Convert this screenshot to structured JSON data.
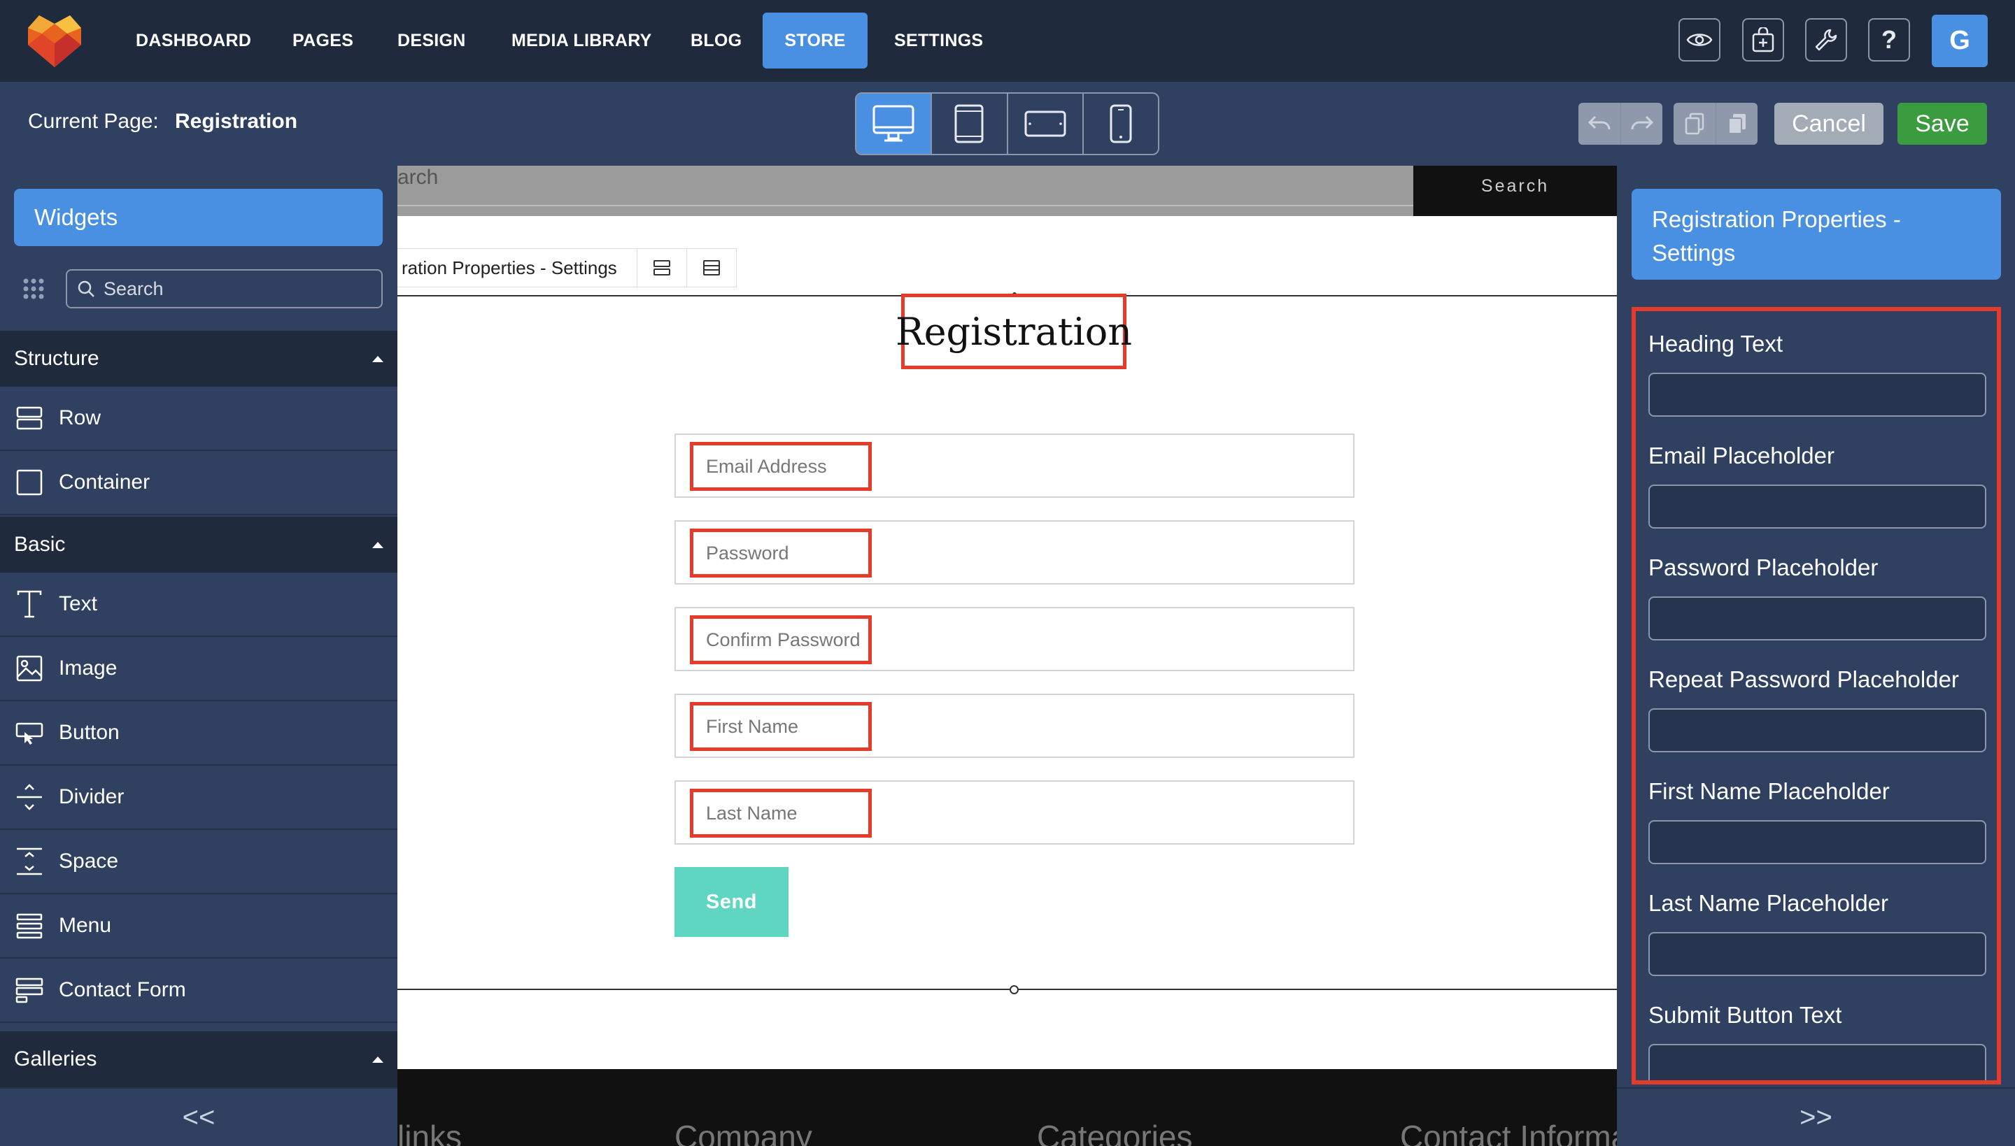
{
  "nav": {
    "items": [
      "DASHBOARD",
      "PAGES",
      "DESIGN",
      "MEDIA LIBRARY",
      "BLOG",
      "STORE",
      "SETTINGS"
    ],
    "active": "STORE",
    "avatar_letter": "G",
    "icons": [
      "preview-eye-icon",
      "store-bag-icon",
      "tools-wrench-icon",
      "help-question-icon"
    ]
  },
  "subbar": {
    "current_page_label": "Current Page:",
    "current_page_value": "Registration",
    "devices": [
      "desktop-icon",
      "tablet-portrait-icon",
      "tablet-landscape-icon",
      "phone-icon"
    ],
    "active_device": "desktop",
    "cancel_label": "Cancel",
    "save_label": "Save"
  },
  "left": {
    "header": "Widgets",
    "search_placeholder": "Search",
    "sections": [
      {
        "title": "Structure",
        "items": [
          "Row",
          "Container"
        ]
      },
      {
        "title": "Basic",
        "items": [
          "Text",
          "Image",
          "Button",
          "Divider",
          "Space",
          "Menu",
          "Contact Form"
        ]
      },
      {
        "title": "Galleries",
        "items": []
      }
    ],
    "collapse_label": "<<"
  },
  "canvas": {
    "top_search_partial": "arch",
    "top_search_button": "Search",
    "breadcrumb": "ration Properties - Settings",
    "heading": "Registration",
    "fields": [
      "Email Address",
      "Password",
      "Confirm Password",
      "First Name",
      "Last Name"
    ],
    "send_label": "Send",
    "footer_cols": [
      "links",
      "Company",
      "Categories",
      "Contact Informat"
    ]
  },
  "right": {
    "header": "Registration Properties - Settings",
    "props": [
      {
        "label": "Heading Text",
        "value": ""
      },
      {
        "label": "Email Placeholder",
        "value": ""
      },
      {
        "label": "Password Placeholder",
        "value": ""
      },
      {
        "label": "Repeat Password Placeholder",
        "value": ""
      },
      {
        "label": "First Name Placeholder",
        "value": ""
      },
      {
        "label": "Last Name Placeholder",
        "value": ""
      },
      {
        "label": "Submit Button Text",
        "value": ""
      }
    ],
    "collapse_label": ">>"
  },
  "colors": {
    "accent": "#4a90e2",
    "nav_bg": "#1f2a3d",
    "panel_bg": "#2f4060",
    "highlight": "#e53b2b",
    "send": "#5fd6c2",
    "save": "#3a9b3f"
  }
}
